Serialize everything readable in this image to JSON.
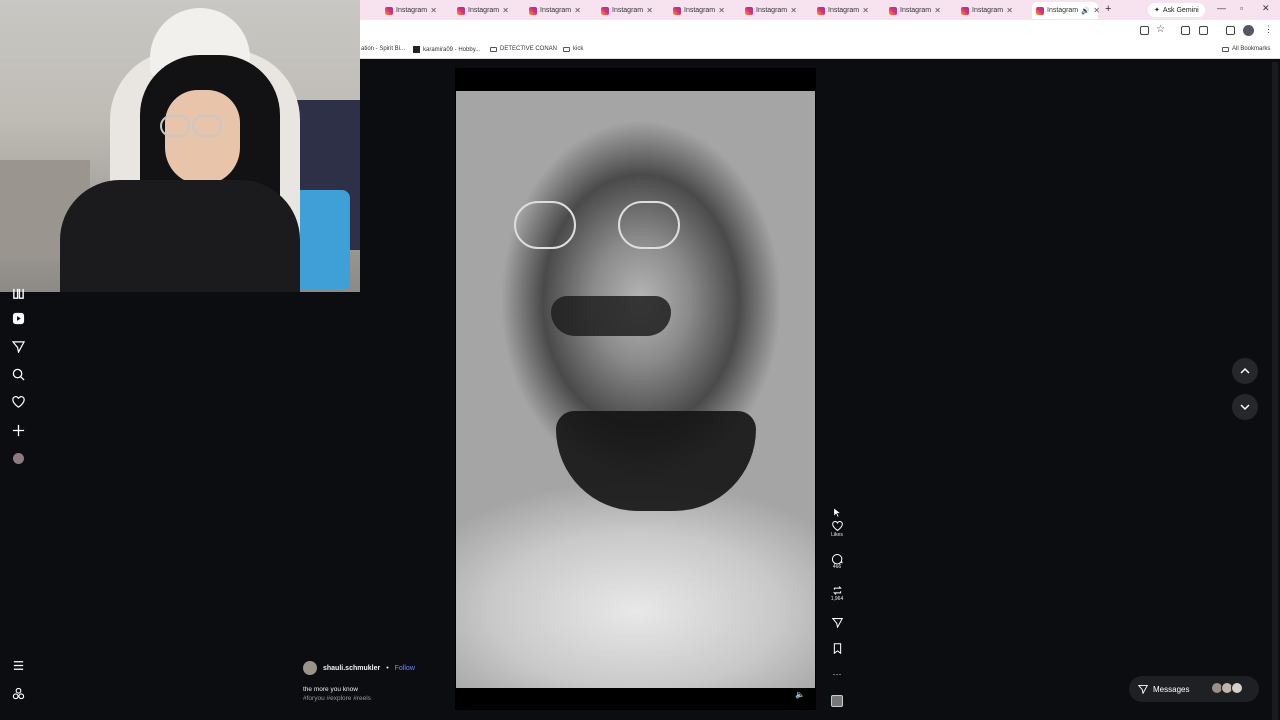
{
  "browser": {
    "tabs": [
      {
        "label": "Instagram"
      },
      {
        "label": "Instagram"
      },
      {
        "label": "Instagram"
      },
      {
        "label": "Instagram"
      },
      {
        "label": "Instagram"
      },
      {
        "label": "Instagram"
      },
      {
        "label": "Instagram"
      },
      {
        "label": "Instagram"
      },
      {
        "label": "Instagram"
      },
      {
        "label": "Instagram"
      }
    ],
    "new_tab": "+",
    "gemini_label": "Ask Gemini",
    "bookmarks": [
      "ation - Spirit Bl...",
      "karamira09 - Hobby...",
      "DETECTIVE CONAN",
      "kick"
    ],
    "all_bookmarks": "All Bookmarks"
  },
  "reel": {
    "author": "shauli.schmukler",
    "separator": "•",
    "follow": "Follow",
    "caption": "the more you know",
    "hashtags": "#foryou #explore #reels",
    "likes_label": "Likes",
    "comments": "466",
    "reposts": "1,964"
  },
  "messages": {
    "label": "Messages"
  },
  "colors": {
    "accent": "#6b8cff",
    "tabbar": "#f7e3ef",
    "background": "#0c0d10"
  }
}
